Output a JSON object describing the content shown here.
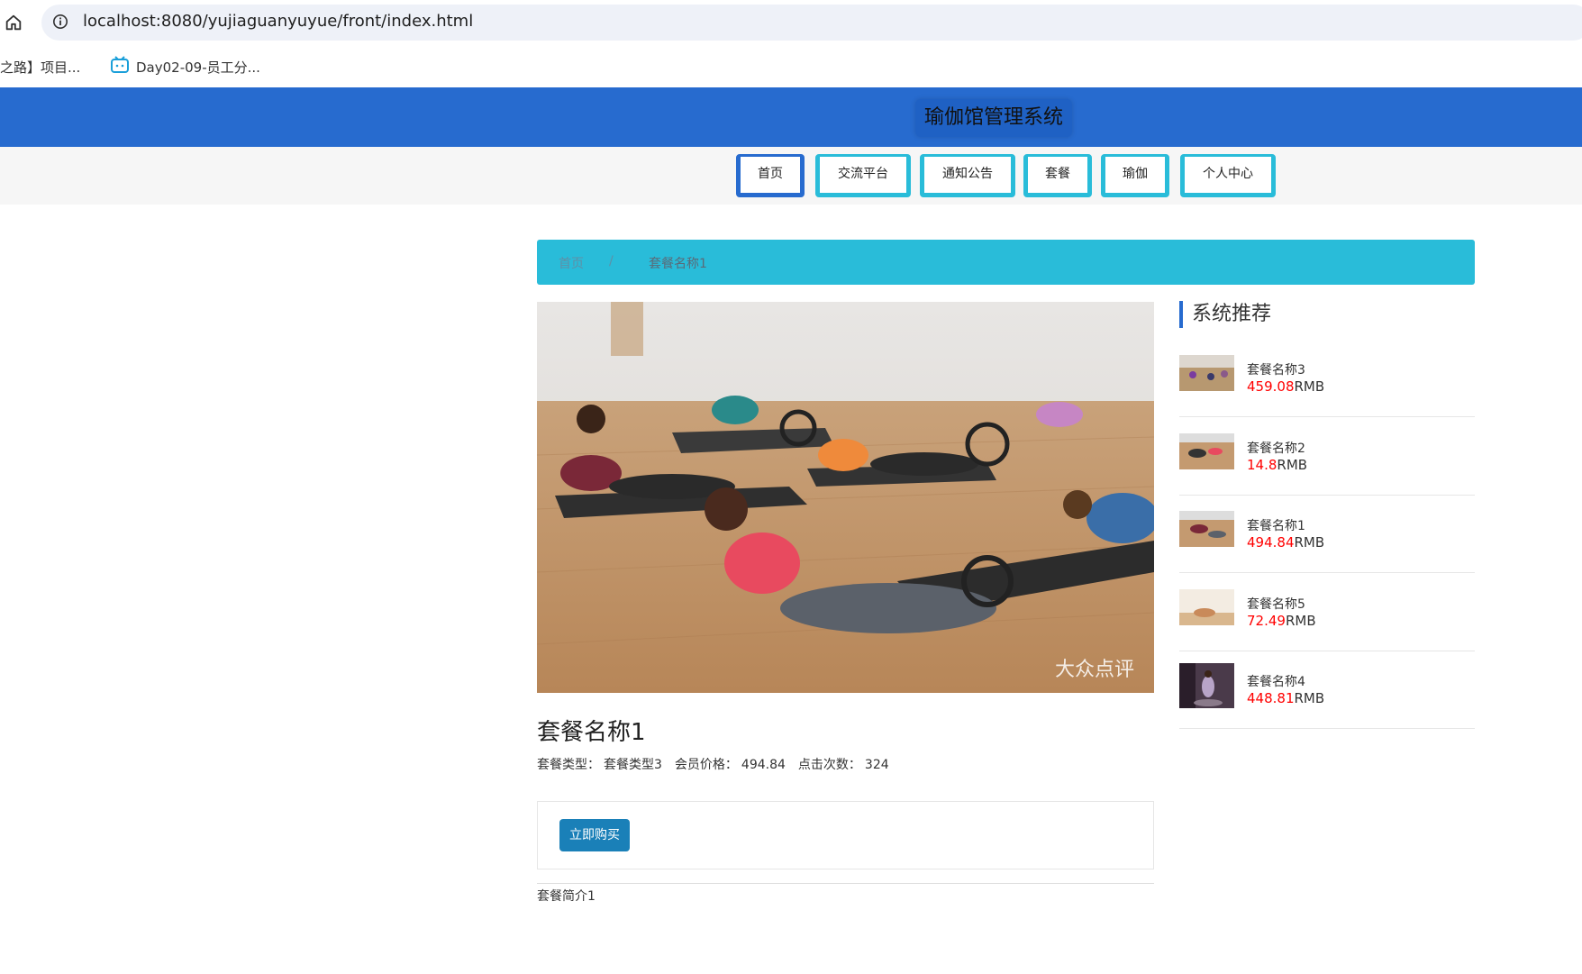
{
  "browser": {
    "url": "localhost:8080/yujiaguanyuyue/front/index.html",
    "bookmarks": [
      "之路】项目...",
      "Day02-09-员工分..."
    ]
  },
  "header": {
    "title": "瑜伽馆管理系统"
  },
  "nav": {
    "items": [
      "首页",
      "交流平台",
      "通知公告",
      "套餐",
      "瑜伽",
      "个人中心"
    ]
  },
  "breadcrumb": {
    "home": "首页",
    "sep": "/",
    "current": "套餐名称1"
  },
  "product": {
    "title": "套餐名称1",
    "type_label": "套餐类型：",
    "type_value": "套餐类型3",
    "price_label": "会员价格：",
    "price_value": "494.84",
    "clicks_label": "点击次数：",
    "clicks_value": "324",
    "buy_label": "立即购买",
    "intro": "套餐简介1",
    "watermark": "大众点评"
  },
  "recommend": {
    "title": "系统推荐",
    "unit": "RMB",
    "items": [
      {
        "name": "套餐名称3",
        "price": "459.08"
      },
      {
        "name": "套餐名称2",
        "price": "14.8"
      },
      {
        "name": "套餐名称1",
        "price": "494.84"
      },
      {
        "name": "套餐名称5",
        "price": "72.49"
      },
      {
        "name": "套餐名称4",
        "price": "448.81"
      }
    ]
  },
  "colors": {
    "header_blue": "#276bcf",
    "nav_cyan": "#29bcd9",
    "buy_button": "#1a80b8",
    "price_red": "#ff0000"
  }
}
